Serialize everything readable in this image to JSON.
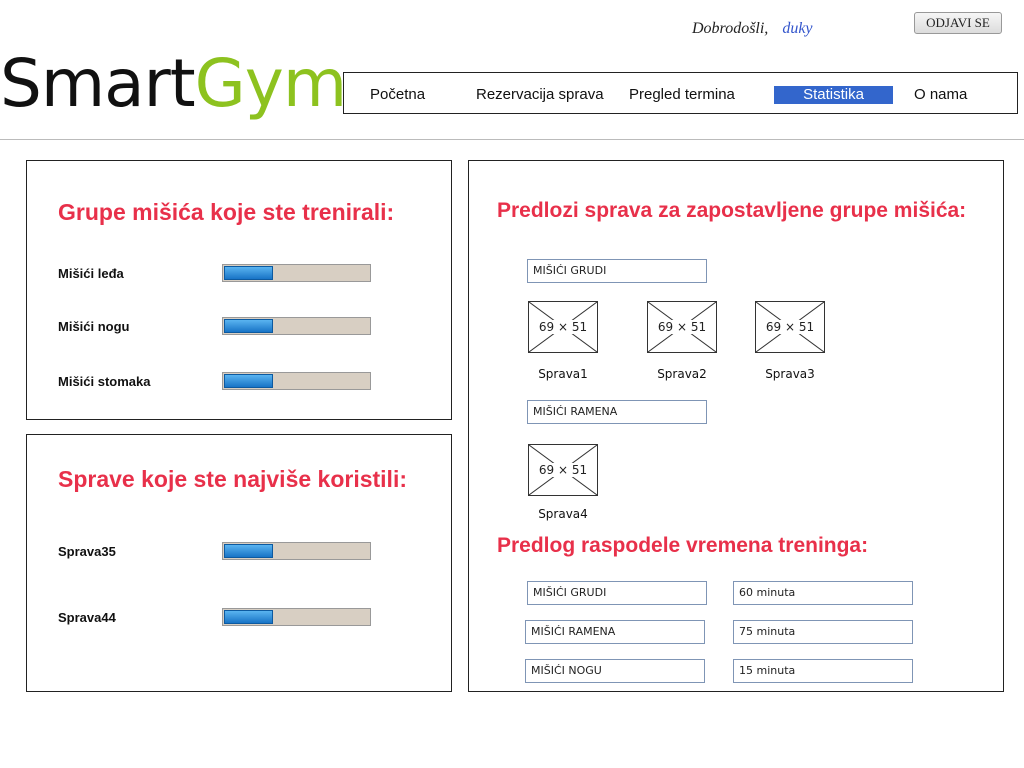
{
  "header": {
    "welcome": "Dobrodošli,",
    "username": "duky",
    "logout_label": "ODJAVI SE",
    "logo_part1": "Smart",
    "logo_part2": "Gym"
  },
  "nav": {
    "items": [
      {
        "label": "Početna"
      },
      {
        "label": "Rezervacija sprava"
      },
      {
        "label": "Pregled termina"
      },
      {
        "label": "Statistika"
      },
      {
        "label": "O nama"
      }
    ],
    "active": "Statistika"
  },
  "muscle_groups": {
    "title": "Grupe mišića koje ste trenirali:",
    "rows": [
      {
        "label": "Mišići leđa",
        "progress_pct": 33
      },
      {
        "label": "Mišići nogu",
        "progress_pct": 33
      },
      {
        "label": "Mišići stomaka",
        "progress_pct": 33
      }
    ]
  },
  "most_used": {
    "title": "Sprave koje ste najviše koristili:",
    "rows": [
      {
        "label": "Sprava35",
        "progress_pct": 33
      },
      {
        "label": "Sprava44",
        "progress_pct": 33
      }
    ]
  },
  "suggestions": {
    "title": "Predlozi sprava za zapostavljene grupe mišića:",
    "groups": [
      {
        "label": "MIŠIĆI GRUDI",
        "devices": [
          {
            "image_text": "69 × 51",
            "name": "Sprava1"
          },
          {
            "image_text": "69 × 51",
            "name": "Sprava2"
          },
          {
            "image_text": "69 × 51",
            "name": "Sprava3"
          }
        ]
      },
      {
        "label": "MIŠIĆI RAMENA",
        "devices": [
          {
            "image_text": "69 × 51",
            "name": "Sprava4"
          }
        ]
      }
    ]
  },
  "time_split": {
    "title": "Predlog raspodele vremena treninga:",
    "rows": [
      {
        "group": "MIŠIĆI GRUDI",
        "time": "60 minuta"
      },
      {
        "group": "MIŠIĆI RAMENA",
        "time": "75 minuta"
      },
      {
        "group": "MIŠIĆI NOGU",
        "time": "15 minuta"
      }
    ]
  },
  "colors": {
    "accent_title": "#e8304a",
    "nav_active": "#3366cc",
    "logo_green": "#8dc21f"
  }
}
